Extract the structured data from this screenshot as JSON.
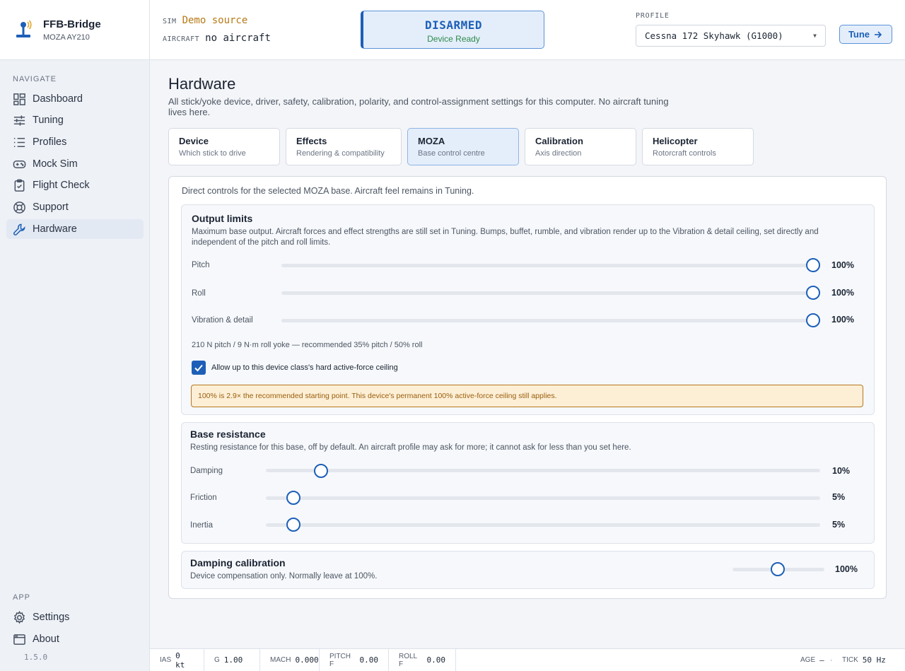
{
  "brand": {
    "title": "FFB-Bridge",
    "subtitle": "MOZA AY210"
  },
  "nav": {
    "heading": "NAVIGATE",
    "items": [
      {
        "label": "Dashboard",
        "icon": "dashboard-icon"
      },
      {
        "label": "Tuning",
        "icon": "sliders-icon"
      },
      {
        "label": "Profiles",
        "icon": "list-icon"
      },
      {
        "label": "Mock Sim",
        "icon": "gamepad-icon"
      },
      {
        "label": "Flight Check",
        "icon": "clipboard-check-icon"
      },
      {
        "label": "Support",
        "icon": "lifebuoy-icon"
      },
      {
        "label": "Hardware",
        "icon": "wrench-icon",
        "active": true
      }
    ],
    "app_heading": "APP",
    "app_items": [
      {
        "label": "Settings",
        "icon": "gear-icon"
      },
      {
        "label": "About",
        "icon": "window-icon"
      }
    ],
    "version": "1.5.0"
  },
  "topbar": {
    "sim_label": "SIM",
    "sim_value": "Demo source",
    "aircraft_label": "AIRCRAFT",
    "aircraft_value": "no aircraft",
    "status_main": "DISARMED",
    "status_sub": "Device Ready",
    "profile_label": "PROFILE",
    "profile_value": "Cessna 172 Skyhawk (G1000)",
    "tune_label": "Tune"
  },
  "page": {
    "title": "Hardware",
    "description": "All stick/yoke device, driver, safety, calibration, polarity, and control-assignment settings for this computer. No aircraft tuning lives here.",
    "tabs": [
      {
        "title": "Device",
        "sub": "Which stick to drive"
      },
      {
        "title": "Effects",
        "sub": "Rendering & compatibility"
      },
      {
        "title": "MOZA",
        "sub": "Base control centre",
        "active": true
      },
      {
        "title": "Calibration",
        "sub": "Axis direction"
      },
      {
        "title": "Helicopter",
        "sub": "Rotorcraft controls"
      }
    ],
    "intro": "Direct controls for the selected MOZA base. Aircraft feel remains in Tuning."
  },
  "output_limits": {
    "title": "Output limits",
    "description": "Maximum base output. Aircraft forces and effect strengths are still set in Tuning. Bumps, buffet, rumble, and vibration render up to the Vibration & detail ceiling, set directly and independent of the pitch and roll limits.",
    "rows": [
      {
        "label": "Pitch",
        "value": 100,
        "display": "100%"
      },
      {
        "label": "Roll",
        "value": 100,
        "display": "100%"
      },
      {
        "label": "Vibration & detail",
        "value": 100,
        "display": "100%"
      }
    ],
    "note": "210 N pitch / 9 N·m roll yoke — recommended 35% pitch / 50% roll",
    "checkbox_label": "Allow up to this device class's hard active-force ceiling",
    "checkbox_checked": true,
    "warning": "100% is 2.9× the recommended starting point. This device's permanent 100% active-force ceiling still applies."
  },
  "base_resistance": {
    "title": "Base resistance",
    "description": "Resting resistance for this base, off by default. An aircraft profile may ask for more; it cannot ask for less than you set here.",
    "rows": [
      {
        "label": "Damping",
        "value": 10,
        "display": "10%"
      },
      {
        "label": "Friction",
        "value": 5,
        "display": "5%"
      },
      {
        "label": "Inertia",
        "value": 5,
        "display": "5%"
      }
    ]
  },
  "damping_calibration": {
    "title": "Damping calibration",
    "description": "Device compensation only. Normally leave at 100%.",
    "value": 100,
    "display": "100%"
  },
  "statusbar": {
    "ias_label": "IAS",
    "ias_value": "0 kt",
    "g_label": "G",
    "g_value": "1.00",
    "mach_label": "MACH",
    "mach_value": "0.000",
    "pitchf_label": "PITCH F",
    "pitchf_value": "0.00",
    "rollf_label": "ROLL F",
    "rollf_value": "0.00",
    "age_label": "AGE",
    "age_value": "—",
    "tick_label": "TICK",
    "tick_value": "50 Hz"
  },
  "colors": {
    "accent": "#1d5fb8",
    "warning_bg": "#fcefd6",
    "warning_border": "#b7791f",
    "ready": "#2b8a4a",
    "demo": "#b77a16"
  }
}
